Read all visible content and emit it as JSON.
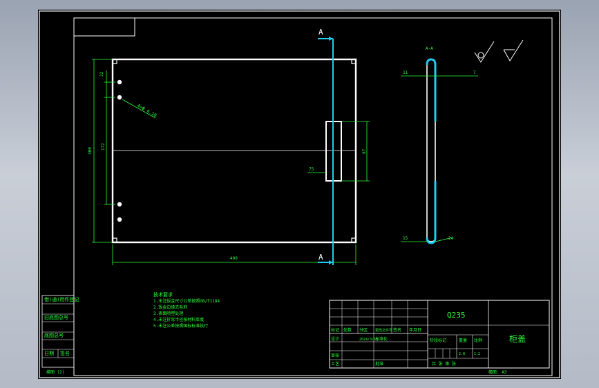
{
  "section_labels": {
    "top": "A",
    "bottom": "A",
    "view": "A-A"
  },
  "dimensions": {
    "hole_top_offset": "22",
    "hole_spec": "4×Φ 4.10",
    "height_total": "300",
    "height_inner": "172",
    "width_total": "400",
    "handle_height": "97",
    "handle_offset": "75",
    "side_top_left": "11",
    "side_top_right": "7",
    "side_bottom_left": "15",
    "side_bottom_right": "24"
  },
  "notes": {
    "title": "技术要求",
    "lines": [
      "1.未注钣金尺寸公差按照GB/T1184",
      "2.钣金边缘去毛刺",
      "3.表面喷塑处理",
      "4.未注折弯半径按材料厚度",
      "5.未注公差按照国标标准执行"
    ]
  },
  "left_block": {
    "rows": [
      "借(通)用件登记",
      "旧底图总号",
      "底图总号",
      "日期",
      "签名"
    ]
  },
  "bottom_left_label": "描图 (2)",
  "title_block": {
    "material": "Q235",
    "part_name": "柜盖",
    "change_header": [
      "标记",
      "处数",
      "分区",
      "更改文件号",
      "签名",
      "年月日"
    ],
    "row_design": [
      "设计",
      "",
      "2024/3/15",
      "标准化",
      "",
      ""
    ],
    "row_review": [
      "审核",
      "",
      "",
      "",
      "",
      ""
    ],
    "row_process": [
      "工艺",
      "",
      "",
      "批准",
      "",
      ""
    ],
    "stage_header": [
      "阶段标记",
      "重量",
      "比例"
    ],
    "scale": "1:2",
    "weight": "2.8",
    "sheet_info": "共  张  第  张",
    "format": "幅面: A3"
  },
  "colors": {
    "background": "#000000",
    "drawing_lines": "#ffffff",
    "dimension_text": "#2cff3a",
    "section_line": "#22ccee"
  }
}
